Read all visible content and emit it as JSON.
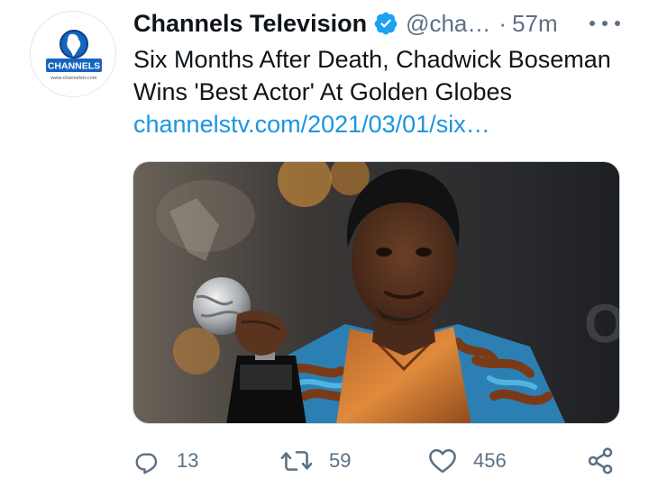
{
  "author": {
    "display_name": "Channels Television",
    "handle": "@cha…",
    "separator": "·",
    "time": "57m",
    "avatar_brand_text": "CHANNELS",
    "avatar_url_text": "www.channelstv.com"
  },
  "tweet": {
    "text": "Six Months After Death, Chadwick Boseman Wins 'Best Actor' At Golden Globes ",
    "link": "channelstv.com/2021/03/01/six…"
  },
  "actions": {
    "reply_count": "13",
    "retweet_count": "59",
    "like_count": "456"
  },
  "colors": {
    "accent": "#1b95e0",
    "verified": "#1da1f2",
    "muted": "#5b7083",
    "text": "#0f1419"
  },
  "icons": {
    "reply": "reply-icon",
    "retweet": "retweet-icon",
    "like": "heart-icon",
    "share": "share-icon",
    "more": "more-icon",
    "verified": "verified-badge-icon"
  }
}
